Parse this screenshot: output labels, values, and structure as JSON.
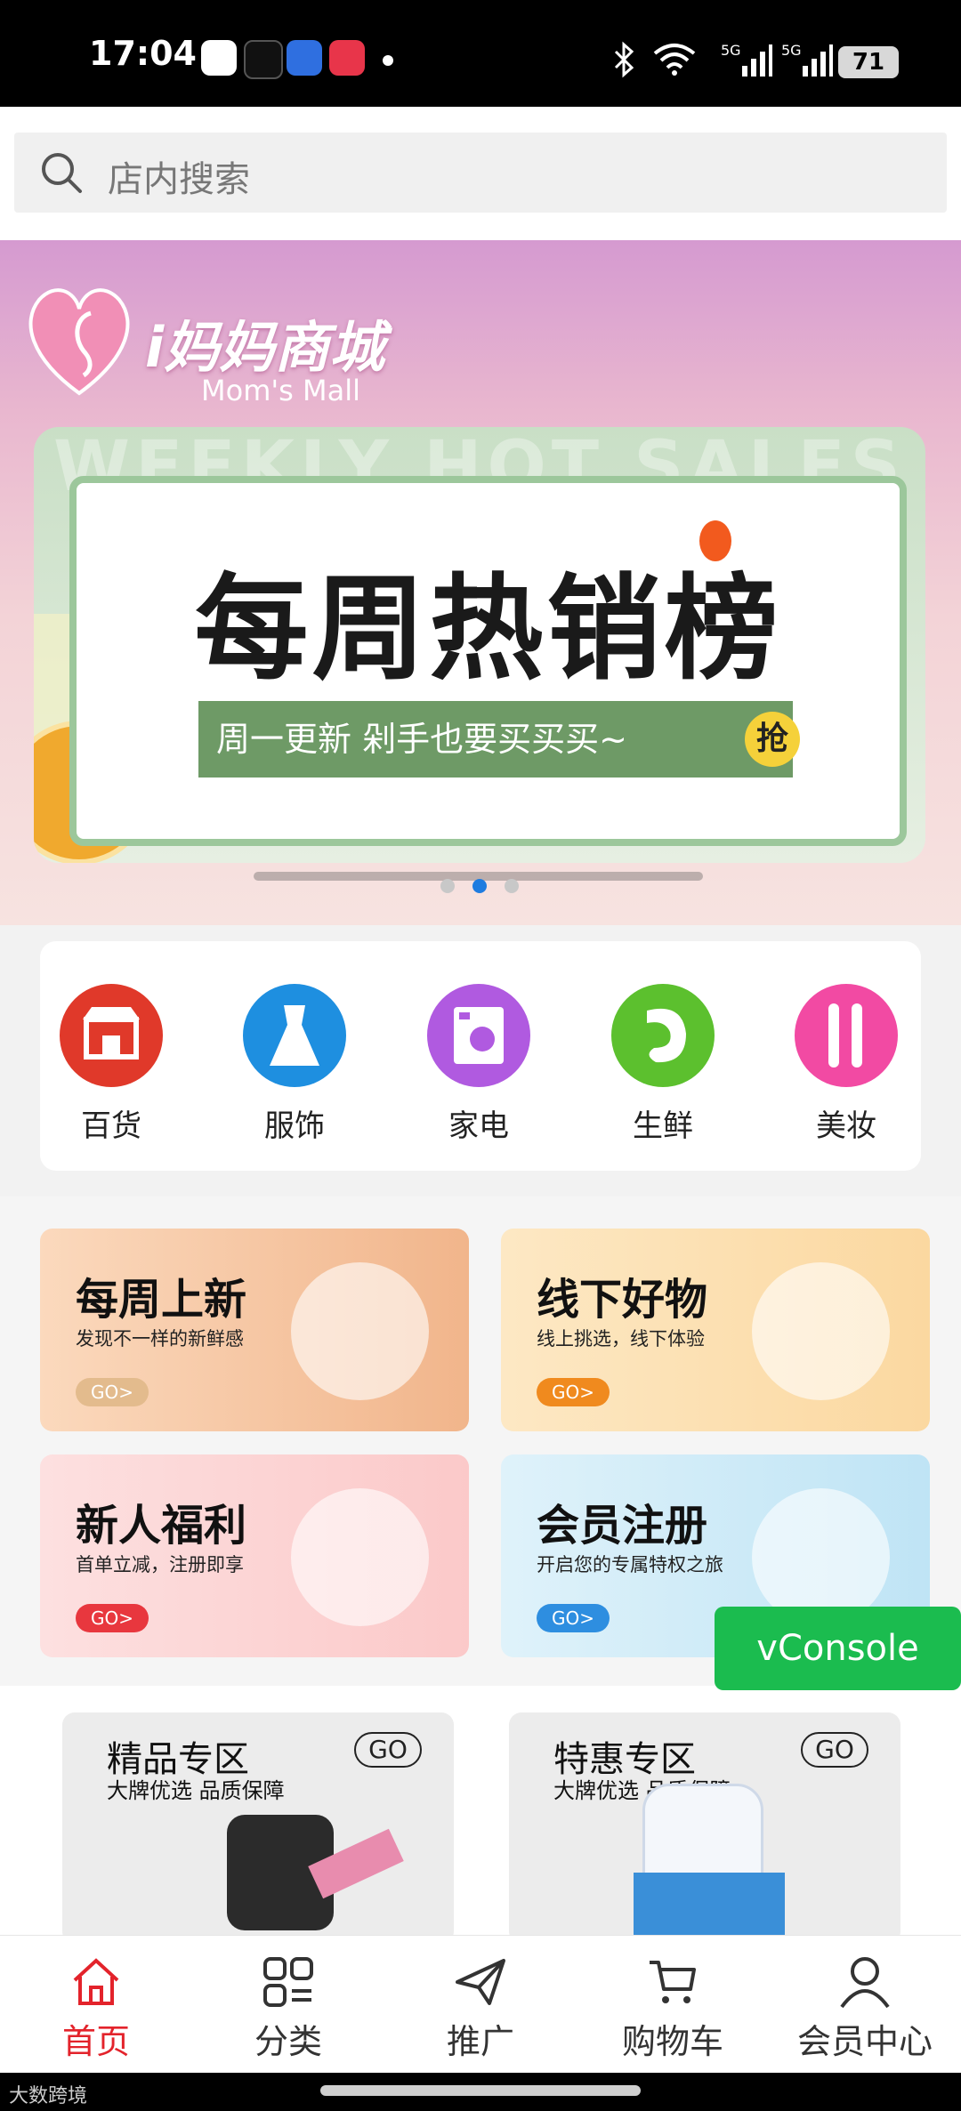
{
  "status_bar": {
    "time": "17:04",
    "battery": "71",
    "network": "5G",
    "icons": [
      "qq-icon",
      "tiktok-icon",
      "baidu-icon",
      "video-icon",
      "dot-icon",
      "bluetooth-icon",
      "wifi-icon",
      "signal-5g-icon",
      "signal-5g-icon-2",
      "battery-icon"
    ]
  },
  "search": {
    "placeholder": "店内搜索"
  },
  "banner": {
    "logo_name": "i妈妈商城",
    "logo_en": "Mom's Mall",
    "watermark": "WEEKLY HOT SALES",
    "title": "每周热销榜",
    "strip": "周一更新  剁手也要买买买~",
    "badge": "抢",
    "active_slide": 2,
    "slides": 3
  },
  "categories": [
    {
      "label": "百货",
      "color": "#e0392a",
      "icon": "store-icon"
    },
    {
      "label": "服饰",
      "color": "#1e8fe0",
      "icon": "dress-icon"
    },
    {
      "label": "家电",
      "color": "#b05ae0",
      "icon": "washer-icon"
    },
    {
      "label": "生鲜",
      "color": "#5cc02e",
      "icon": "shrimp-icon"
    },
    {
      "label": "美妆",
      "color": "#f24aa3",
      "icon": "makeup-brush-icon"
    }
  ],
  "promos": [
    {
      "title": "每周上新",
      "subtitle": "发现不一样的新鲜感",
      "go": "GO>",
      "bg": "#f6caa5",
      "go_color": "#e0b080"
    },
    {
      "title": "线下好物",
      "subtitle": "线上挑选，线下体验",
      "go": "GO>",
      "bg": "#fde2b3",
      "go_color": "#f08a1e"
    },
    {
      "title": "新人福利",
      "subtitle": "首单立减，注册即享",
      "go": "GO>",
      "bg": "#fdd3d3",
      "go_color": "#e8373e"
    },
    {
      "title": "会员注册",
      "subtitle": "开启您的专属特权之旅",
      "go": "GO>",
      "bg": "#cdeaf7",
      "go_color": "#2e8ee0"
    }
  ],
  "zones": [
    {
      "title": "精品专区",
      "subtitle": "大牌优选 品质保障",
      "go": "GO"
    },
    {
      "title": "特惠专区",
      "subtitle": "大牌优选 品质保障",
      "go": "GO"
    }
  ],
  "vconsole": "vConsole",
  "tabs": [
    {
      "label": "首页",
      "icon": "home-icon",
      "active": true
    },
    {
      "label": "分类",
      "icon": "category-icon",
      "active": false
    },
    {
      "label": "推广",
      "icon": "paper-plane-icon",
      "active": false
    },
    {
      "label": "购物车",
      "icon": "cart-icon",
      "active": false
    },
    {
      "label": "会员中心",
      "icon": "user-icon",
      "active": false
    }
  ],
  "accent_color": "#e3232b",
  "watermark_bottom": "大数跨境"
}
